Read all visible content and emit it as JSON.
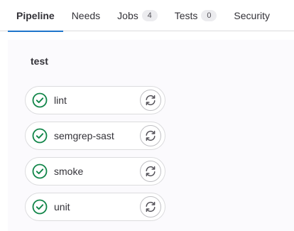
{
  "tabs": [
    {
      "label": "Pipeline",
      "active": true
    },
    {
      "label": "Needs"
    },
    {
      "label": "Jobs",
      "count": "4"
    },
    {
      "label": "Tests",
      "count": "0"
    },
    {
      "label": "Security"
    }
  ],
  "stage": {
    "title": "test",
    "jobs": [
      {
        "name": "lint",
        "status_icon": "check-circle-icon",
        "action_icon": "retry-icon"
      },
      {
        "name": "semgrep-sast",
        "status_icon": "check-circle-icon",
        "action_icon": "retry-icon"
      },
      {
        "name": "smoke",
        "status_icon": "check-circle-icon",
        "action_icon": "retry-icon"
      },
      {
        "name": "unit",
        "status_icon": "check-circle-icon",
        "action_icon": "retry-icon"
      }
    ]
  },
  "colors": {
    "success": "#108548",
    "tab_indicator": "#1f75cb",
    "panel_bg": "#fbfafd"
  }
}
